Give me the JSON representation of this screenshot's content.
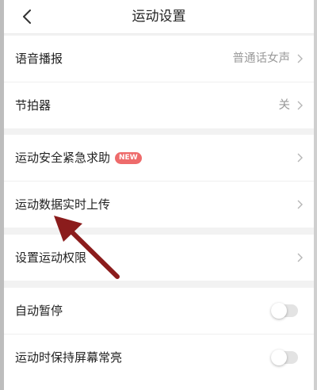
{
  "header": {
    "title": "运动设置",
    "back_icon": "chevron-left-icon"
  },
  "group1": {
    "voice": {
      "label": "语音播报",
      "value": "普通话女声"
    },
    "metronome": {
      "label": "节拍器",
      "value": "关"
    }
  },
  "group2": {
    "emergency": {
      "label": "运动安全紧急求助",
      "badge": "NEW"
    },
    "upload": {
      "label": "运动数据实时上传"
    }
  },
  "group3": {
    "permission": {
      "label": "设置运动权限"
    }
  },
  "group4": {
    "auto_pause": {
      "label": "自动暂停",
      "enabled": false
    },
    "screen_on": {
      "label": "运动时保持屏幕常亮",
      "enabled": false
    }
  },
  "colors": {
    "badge": "#ee6b6b",
    "annotation_arrow": "#8b1c1c",
    "section_gap": "#f2f2f2"
  }
}
